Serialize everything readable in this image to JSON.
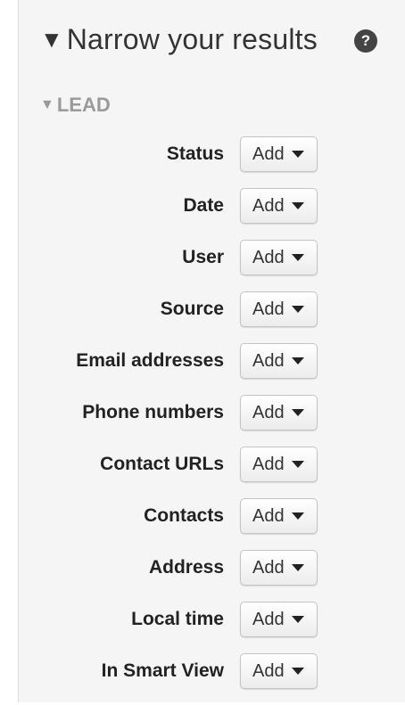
{
  "header": {
    "caret": "▼",
    "title": "Narrow your results",
    "help_glyph": "?"
  },
  "section": {
    "caret": "▼",
    "title": "LEAD"
  },
  "filters": [
    {
      "label": "Status",
      "button": "Add"
    },
    {
      "label": "Date",
      "button": "Add"
    },
    {
      "label": "User",
      "button": "Add"
    },
    {
      "label": "Source",
      "button": "Add"
    },
    {
      "label": "Email addresses",
      "button": "Add"
    },
    {
      "label": "Phone numbers",
      "button": "Add"
    },
    {
      "label": "Contact URLs",
      "button": "Add"
    },
    {
      "label": "Contacts",
      "button": "Add"
    },
    {
      "label": "Address",
      "button": "Add"
    },
    {
      "label": "Local time",
      "button": "Add"
    },
    {
      "label": "In Smart View",
      "button": "Add"
    }
  ]
}
